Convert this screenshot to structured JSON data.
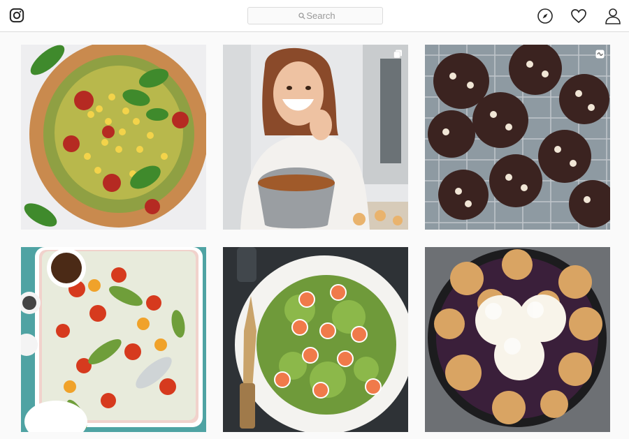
{
  "header": {
    "search": {
      "placeholder": "Search",
      "value": ""
    },
    "icons": [
      "instagram-logo-icon",
      "search-icon",
      "compass-icon",
      "heart-icon",
      "person-icon"
    ]
  },
  "grid": {
    "posts": [
      {
        "subject": "pizza",
        "badge": null
      },
      {
        "subject": "woman-with-bowl",
        "badge": "carousel-icon"
      },
      {
        "subject": "cookies",
        "badge": "boomerang-icon"
      },
      {
        "subject": "vegetable-tray",
        "badge": null
      },
      {
        "subject": "shrimp-pasta",
        "badge": null
      },
      {
        "subject": "cobbler-ice-cream",
        "badge": null
      }
    ]
  },
  "colors": {
    "border": "#dbdbdb",
    "background": "#fafafa",
    "icon": "#262626"
  }
}
